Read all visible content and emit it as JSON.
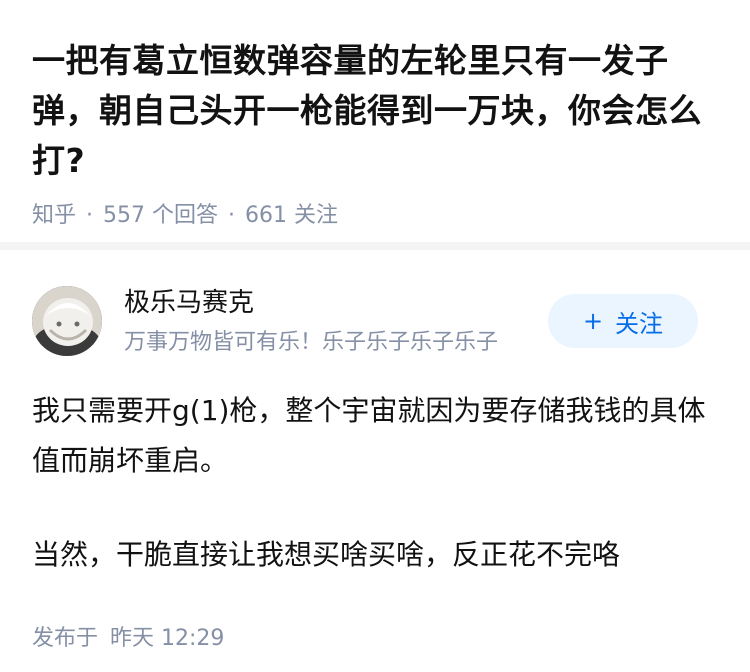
{
  "question": {
    "title": "一把有葛立恒数弹容量的左轮里只有一发子弹，朝自己头开一枪能得到一万块，你会怎么打?",
    "source": "知乎",
    "answers_count": "557",
    "answers_label": "个回答",
    "followers_count": "661",
    "followers_label": "关注"
  },
  "answer": {
    "author_name": "极乐马赛克",
    "author_bio": "万事万物皆可有乐！乐子乐子乐子乐子",
    "follow_plus": "+",
    "follow_label": "关注",
    "paragraphs": [
      "我只需要开g(1)枪，整个宇宙就因为要存储我钱的具体值而崩坏重启。",
      "当然，干脆直接让我想买啥买啥，反正花不完咯"
    ],
    "publish_prefix": "发布于",
    "publish_time": "昨天 12:29"
  },
  "icons": {
    "avatar": "avatar-image"
  }
}
